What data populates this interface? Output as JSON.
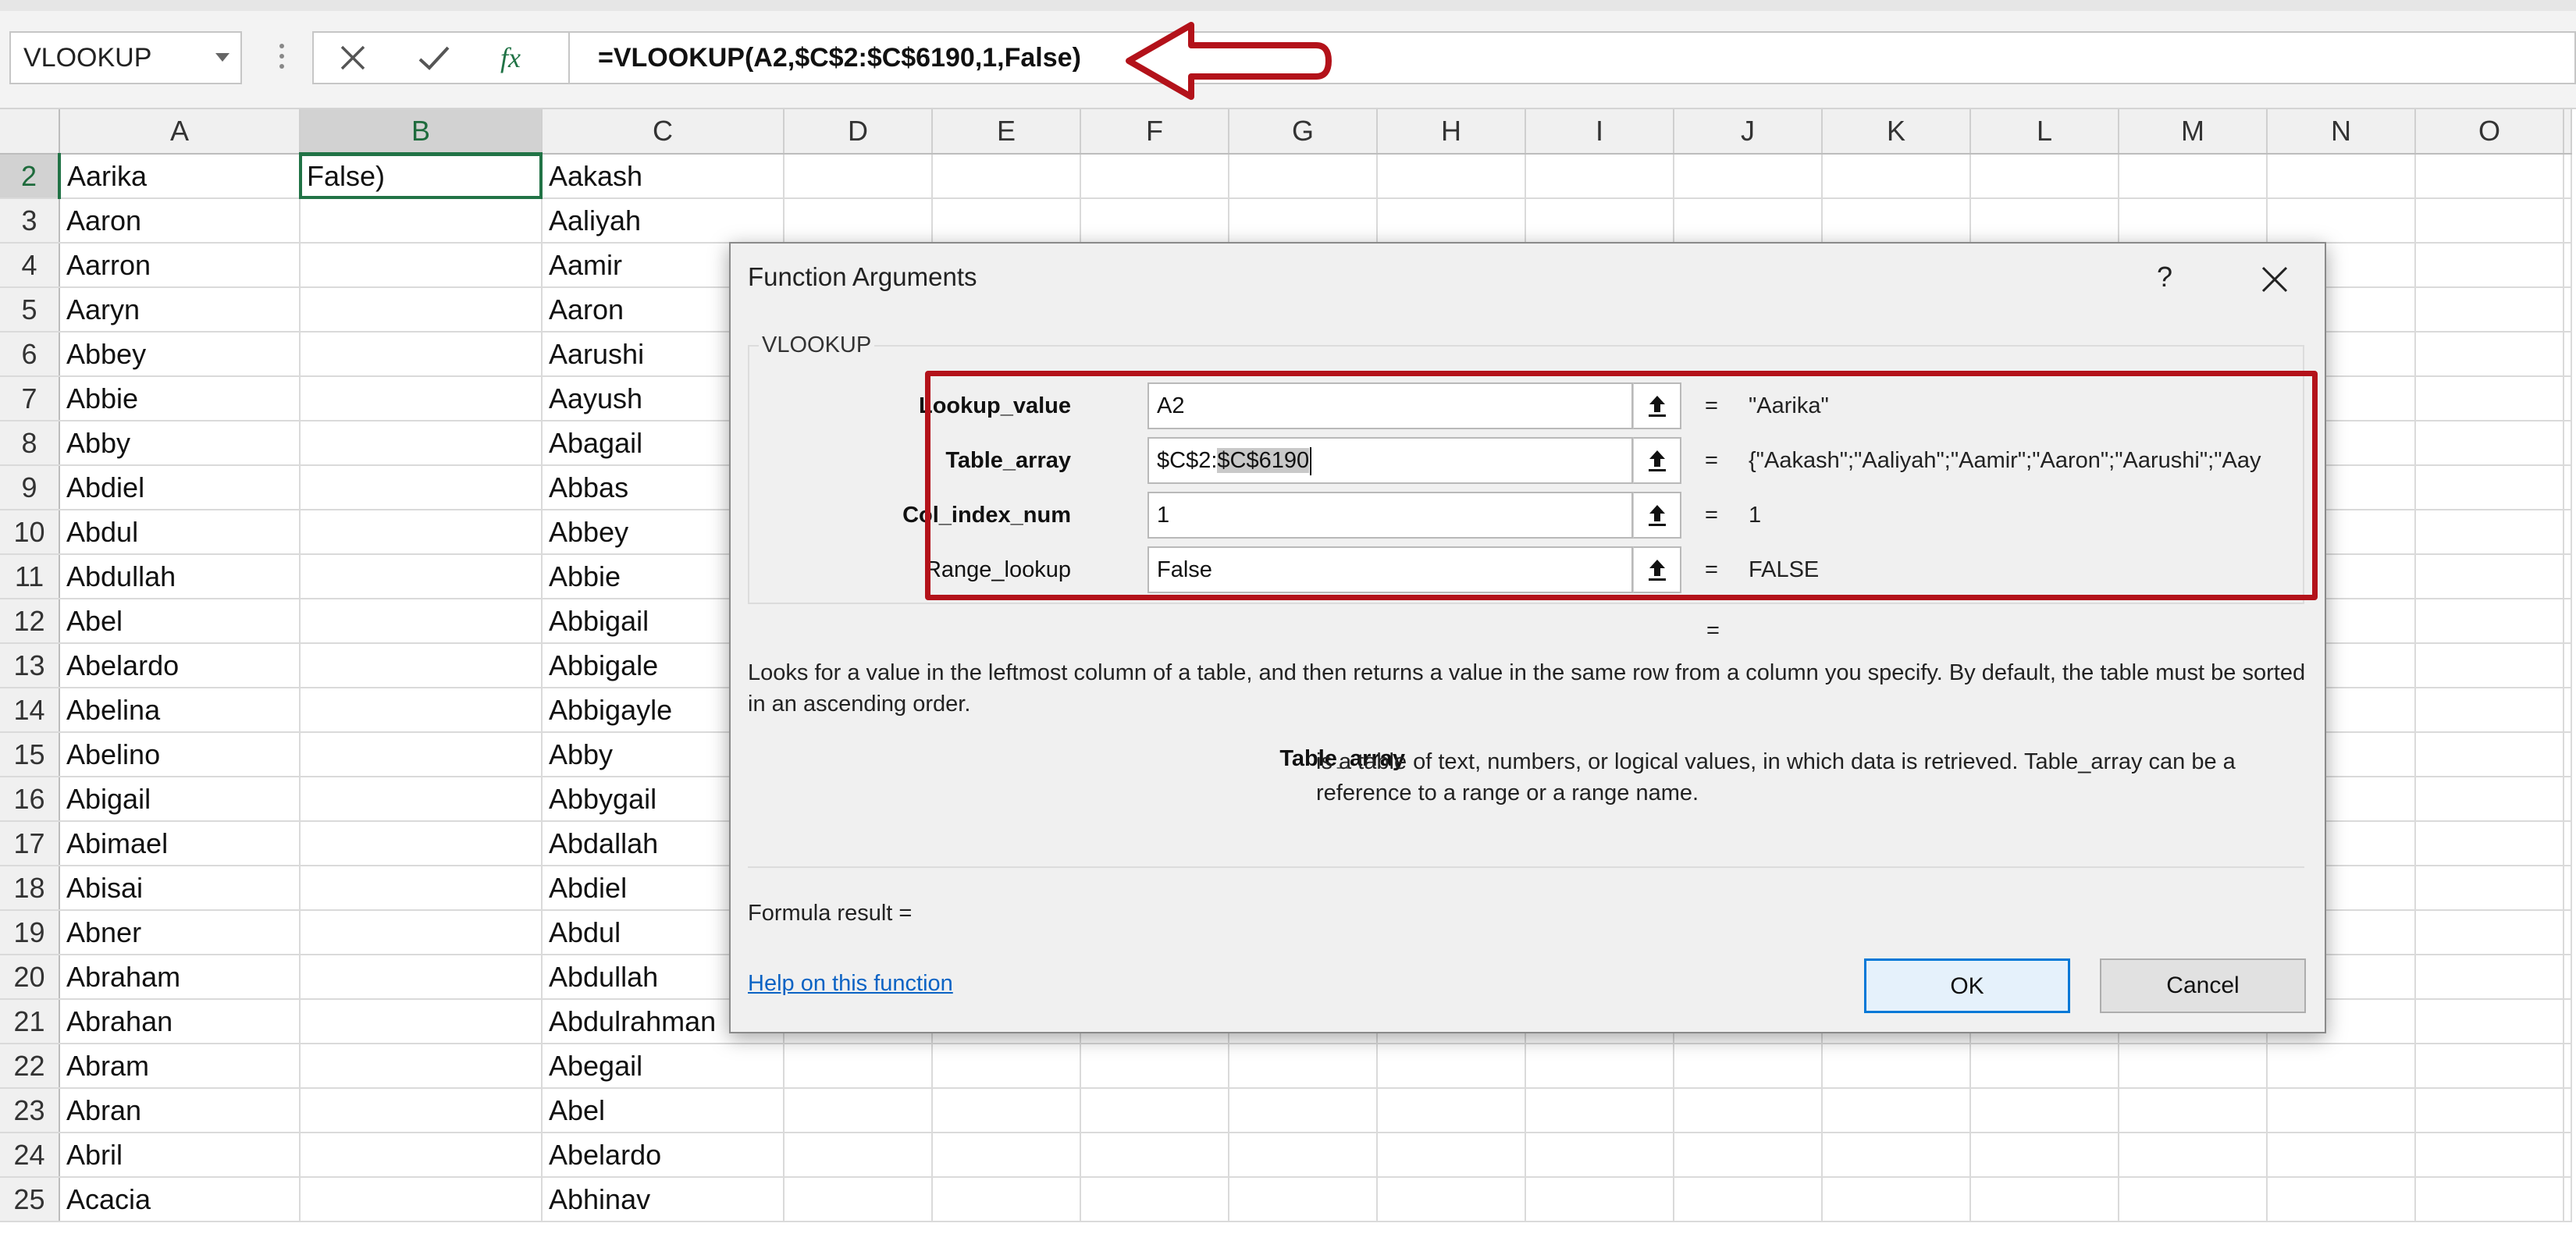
{
  "formula_bar": {
    "name_box": "VLOOKUP",
    "formula": "=VLOOKUP(A2,$C$2:$C$6190,1,False)",
    "icons": [
      "cancel-x-icon",
      "enter-check-icon",
      "insert-function-fx-icon"
    ]
  },
  "sheet": {
    "columns": [
      "A",
      "B",
      "C",
      "D",
      "E",
      "F",
      "G",
      "H",
      "I",
      "J",
      "K",
      "L",
      "M",
      "N",
      "O"
    ],
    "active_column": "B",
    "active_row": "2",
    "rows": [
      {
        "num": "2",
        "a": "Aarika",
        "b": "False)",
        "c": "Aakash"
      },
      {
        "num": "3",
        "a": "Aaron",
        "b": "",
        "c": "Aaliyah"
      },
      {
        "num": "4",
        "a": "Aarron",
        "b": "",
        "c": "Aamir"
      },
      {
        "num": "5",
        "a": "Aaryn",
        "b": "",
        "c": "Aaron"
      },
      {
        "num": "6",
        "a": "Abbey",
        "b": "",
        "c": "Aarushi"
      },
      {
        "num": "7",
        "a": "Abbie",
        "b": "",
        "c": "Aayush"
      },
      {
        "num": "8",
        "a": "Abby",
        "b": "",
        "c": "Abagail"
      },
      {
        "num": "9",
        "a": "Abdiel",
        "b": "",
        "c": "Abbas"
      },
      {
        "num": "10",
        "a": "Abdul",
        "b": "",
        "c": "Abbey"
      },
      {
        "num": "11",
        "a": "Abdullah",
        "b": "",
        "c": "Abbie"
      },
      {
        "num": "12",
        "a": "Abel",
        "b": "",
        "c": "Abbigail"
      },
      {
        "num": "13",
        "a": "Abelardo",
        "b": "",
        "c": "Abbigale"
      },
      {
        "num": "14",
        "a": "Abelina",
        "b": "",
        "c": "Abbigayle"
      },
      {
        "num": "15",
        "a": "Abelino",
        "b": "",
        "c": "Abby"
      },
      {
        "num": "16",
        "a": "Abigail",
        "b": "",
        "c": "Abbygail"
      },
      {
        "num": "17",
        "a": "Abimael",
        "b": "",
        "c": "Abdallah"
      },
      {
        "num": "18",
        "a": "Abisai",
        "b": "",
        "c": "Abdiel"
      },
      {
        "num": "19",
        "a": "Abner",
        "b": "",
        "c": "Abdul"
      },
      {
        "num": "20",
        "a": "Abraham",
        "b": "",
        "c": "Abdullah"
      },
      {
        "num": "21",
        "a": "Abrahan",
        "b": "",
        "c": "Abdulrahman"
      },
      {
        "num": "22",
        "a": "Abram",
        "b": "",
        "c": "Abegail"
      },
      {
        "num": "23",
        "a": "Abran",
        "b": "",
        "c": "Abel"
      },
      {
        "num": "24",
        "a": "Abril",
        "b": "",
        "c": "Abelardo"
      },
      {
        "num": "25",
        "a": "Acacia",
        "b": "",
        "c": "Abhinav"
      }
    ]
  },
  "dialog": {
    "title": "Function Arguments",
    "help_glyph": "?",
    "group_label": "VLOOKUP",
    "args": [
      {
        "label": "Lookup_value",
        "input": "A2",
        "result": "\"Aarika\""
      },
      {
        "label": "Table_array",
        "input_plain": "$C$2:",
        "input_selected": "$C$6190",
        "result": "{\"Aakash\";\"Aaliyah\";\"Aamir\";\"Aaron\";\"Aarushi\";\"Aay"
      },
      {
        "label": "Col_index_num",
        "input": "1",
        "result": "1"
      },
      {
        "label": "Range_lookup",
        "input": "False",
        "result": "FALSE"
      }
    ],
    "equals_sign": "=",
    "description": "Looks for a value in the leftmost column of a table, and then returns a value in the same row from a column you specify. By default, the table must be sorted in an ascending order.",
    "arg_help_name": "Table_array",
    "arg_help_text": "is a table of text, numbers, or logical values, in which data is retrieved. Table_array can be a reference to a range or a range name.",
    "formula_result_label": "Formula result =",
    "help_link": "Help on this function",
    "ok_label": "OK",
    "cancel_label": "Cancel"
  },
  "colors": {
    "excel_green": "#217346",
    "annotation_red": "#b3121a",
    "link_blue": "#0b63c4"
  }
}
